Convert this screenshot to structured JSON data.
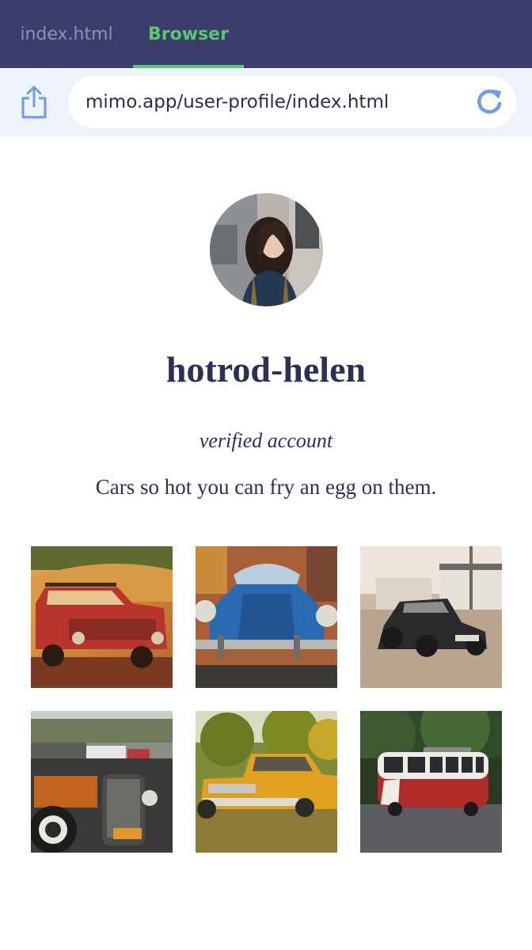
{
  "tabs": {
    "index_label": "index.html",
    "browser_label": "Browser"
  },
  "address_bar": {
    "url": "mimo.app/user-profile/index.html"
  },
  "profile": {
    "username": "hotrod-helen",
    "verified_text": "verified account",
    "bio": "Cars so hot you can fry an egg on them."
  },
  "colors": {
    "tabbar_bg": "#3b3d6b",
    "active_tab": "#58c96e",
    "inactive_tab": "#8f92b7",
    "address_bg": "#eef2f9",
    "icon_blue": "#6f9be8",
    "text_navy": "#2e2f55"
  },
  "icons": {
    "share": "share-icon",
    "reload": "reload-icon"
  },
  "gallery": [
    {
      "subject": "red vintage car in golden field"
    },
    {
      "subject": "blue vintage beetle car front"
    },
    {
      "subject": "black hot rod on street"
    },
    {
      "subject": "hot rod engine in parking lot"
    },
    {
      "subject": "yellow vintage pickup truck on grass"
    },
    {
      "subject": "red and white vintage bus"
    }
  ]
}
